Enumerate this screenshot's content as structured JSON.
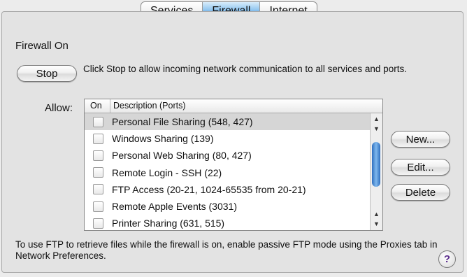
{
  "tabs": [
    {
      "label": "Services",
      "active": false
    },
    {
      "label": "Firewall",
      "active": true
    },
    {
      "label": "Internet",
      "active": false
    }
  ],
  "firewall": {
    "status_title": "Firewall On",
    "stop_button": "Stop",
    "stop_description": "Click Stop to allow incoming network communication to all services and ports."
  },
  "allow": {
    "label": "Allow:",
    "columns": {
      "on": "On",
      "description": "Description (Ports)"
    },
    "rows": [
      {
        "label": "Personal File Sharing (548, 427)",
        "checked": false,
        "selected": true
      },
      {
        "label": "Windows Sharing (139)",
        "checked": false,
        "selected": false
      },
      {
        "label": "Personal Web Sharing (80, 427)",
        "checked": false,
        "selected": false
      },
      {
        "label": "Remote Login - SSH (22)",
        "checked": false,
        "selected": false
      },
      {
        "label": "FTP Access (20-21, 1024-65535 from 20-21)",
        "checked": false,
        "selected": false
      },
      {
        "label": "Remote Apple Events (3031)",
        "checked": false,
        "selected": false
      },
      {
        "label": "Printer Sharing (631, 515)",
        "checked": false,
        "selected": false
      }
    ]
  },
  "buttons": {
    "new": "New...",
    "edit": "Edit...",
    "delete": "Delete"
  },
  "footer_note": "To use FTP to retrieve files while the firewall is on, enable passive FTP mode using the Proxies tab in Network Preferences.",
  "help_label": "?",
  "icons": {
    "scroll_up": "up-arrow",
    "scroll_down": "down-arrow",
    "help": "help-icon"
  },
  "colors": {
    "active_tab": "#7fbcee",
    "scroll_thumb": "#3f86d8",
    "selected_row": "#d6d6d6"
  }
}
